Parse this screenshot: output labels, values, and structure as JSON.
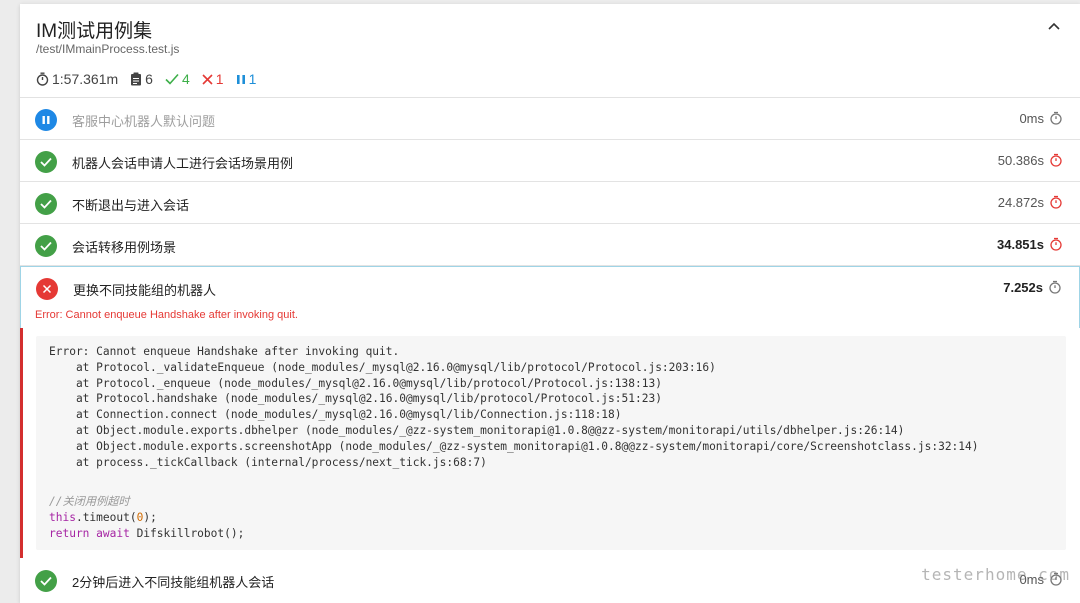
{
  "suite": {
    "title": "IM测试用例集",
    "file": "/test/IMmainProcess.test.js",
    "stats": {
      "duration": "1:57.361m",
      "total": "6",
      "passed": "4",
      "failed": "1",
      "pending": "1"
    }
  },
  "tests": [
    {
      "status": "pending",
      "title": "客服中心机器人默认问题",
      "duration": "0ms"
    },
    {
      "status": "passed",
      "title": "机器人会话申请人工进行会话场景用例",
      "duration": "50.386s"
    },
    {
      "status": "passed",
      "title": "不断退出与进入会话",
      "duration": "24.872s"
    },
    {
      "status": "passed",
      "title": "会话转移用例场景",
      "duration": "34.851s"
    },
    {
      "status": "failed",
      "title": "更换不同技能组的机器人",
      "duration": "7.252s",
      "error": "Error: Cannot enqueue Handshake after invoking quit."
    },
    {
      "status": "passed",
      "title": "2分钟后进入不同技能组机器人会话",
      "duration": "0ms"
    }
  ],
  "stack_trace": [
    "Error: Cannot enqueue Handshake after invoking quit.",
    "    at Protocol._validateEnqueue (node_modules/_mysql@2.16.0@mysql/lib/protocol/Protocol.js:203:16)",
    "    at Protocol._enqueue (node_modules/_mysql@2.16.0@mysql/lib/protocol/Protocol.js:138:13)",
    "    at Protocol.handshake (node_modules/_mysql@2.16.0@mysql/lib/protocol/Protocol.js:51:23)",
    "    at Connection.connect (node_modules/_mysql@2.16.0@mysql/lib/Connection.js:118:18)",
    "    at Object.module.exports.dbhelper (node_modules/_@zz-system_monitorapi@1.0.8@@zz-system/monitorapi/utils/dbhelper.js:26:14)",
    "    at Object.module.exports.screenshotApp (node_modules/_@zz-system_monitorapi@1.0.8@@zz-system/monitorapi/core/Screenshotclass.js:32:14)",
    "    at process._tickCallback (internal/process/next_tick.js:68:7)"
  ],
  "snippet": {
    "comment": "//关闭用例超时",
    "this_kw": "this",
    "timeout_call": ".timeout(",
    "timeout_arg": "0",
    "timeout_end": ");",
    "return_kw": "return await",
    "return_expr": " Difskillrobot();"
  },
  "watermark": "testerhome.com",
  "colors": {
    "pass": "#43a047",
    "fail": "#e53935",
    "pending": "#1e88e5"
  }
}
